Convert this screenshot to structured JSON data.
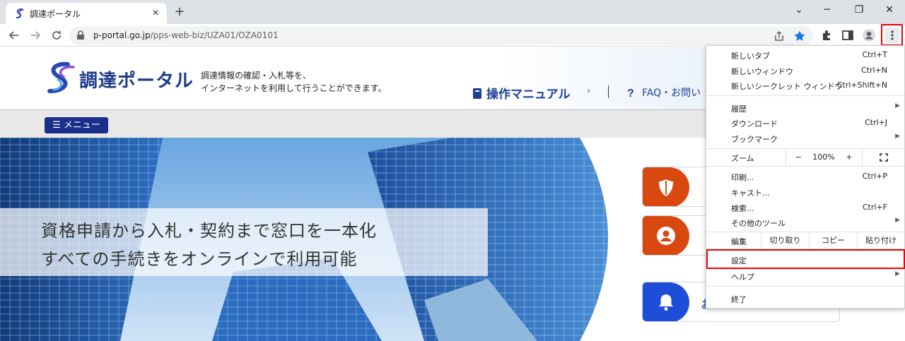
{
  "tab": {
    "title": "調達ポータル",
    "close": "✕",
    "new": "+"
  },
  "window": {
    "minimize": "─",
    "maximize": "❐",
    "close": "✕",
    "tab_search": "⌄"
  },
  "toolbar": {
    "url_domain": "p-portal.go.jp",
    "url_path": "/pps-web-biz/UZA01/OZA0101"
  },
  "site": {
    "logo_text": "調達ポータル",
    "tagline_1": "調達情報の確認・入札等を、",
    "tagline_2": "インターネットを利用して行うことができます。",
    "manual": "操作マニュアル",
    "manual_chevron": "›",
    "faq": "FAQ・お問い",
    "menu_button": "☰ メニュー",
    "hero_line_1": "資格申請から入札・契約まで窓口を一本化",
    "hero_line_2": "すべての手続きをオンラインで利用可能",
    "notice_partial": "お"
  },
  "chrome_menu": {
    "new_tab": {
      "label": "新しいタブ",
      "shortcut": "Ctrl+T"
    },
    "new_window": {
      "label": "新しいウィンドウ",
      "shortcut": "Ctrl+N"
    },
    "incognito": {
      "label": "新しいシークレット ウィンドウ",
      "shortcut": "Ctrl+Shift+N"
    },
    "history": {
      "label": "履歴"
    },
    "downloads": {
      "label": "ダウンロード",
      "shortcut": "Ctrl+J"
    },
    "bookmarks": {
      "label": "ブックマーク"
    },
    "zoom": {
      "label": "ズーム",
      "minus": "−",
      "value": "100%",
      "plus": "+"
    },
    "print": {
      "label": "印刷...",
      "shortcut": "Ctrl+P"
    },
    "cast": {
      "label": "キャスト..."
    },
    "find": {
      "label": "検索...",
      "shortcut": "Ctrl+F"
    },
    "more_tools": {
      "label": "その他のツール"
    },
    "edit": {
      "label": "編集",
      "cut": "切り取り",
      "copy": "コピー",
      "paste": "貼り付け"
    },
    "settings": {
      "label": "設定"
    },
    "help": {
      "label": "ヘルプ"
    },
    "exit": {
      "label": "終了"
    },
    "submenu_arrow": "▶"
  },
  "colors": {
    "accent_red": "#e00000",
    "brand_navy": "#1a2f8a",
    "orange": "#d9480f",
    "blue_badge": "#1d4ed8"
  }
}
